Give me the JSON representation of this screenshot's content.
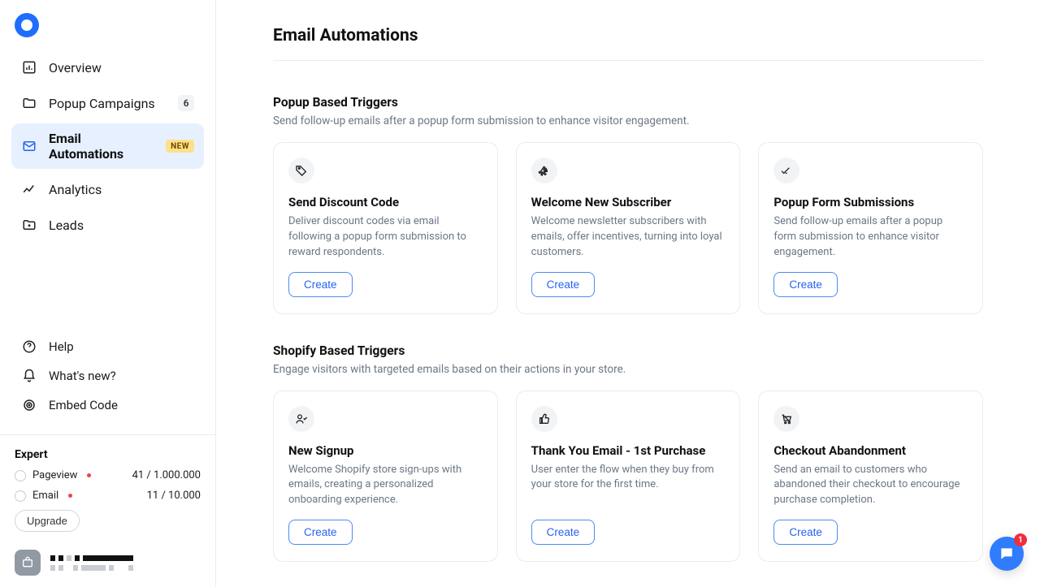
{
  "sidebar": {
    "nav": [
      {
        "label": "Overview"
      },
      {
        "label": "Popup Campaigns",
        "count": "6"
      },
      {
        "label": "Email Automations",
        "badge": "NEW"
      },
      {
        "label": "Analytics"
      },
      {
        "label": "Leads"
      }
    ],
    "secondary": [
      {
        "label": "Help"
      },
      {
        "label": "What's new?"
      },
      {
        "label": "Embed Code"
      }
    ],
    "plan": {
      "title": "Expert",
      "rows": [
        {
          "label": "Pageview",
          "value": "41 / 1.000.000"
        },
        {
          "label": "Email",
          "value": "11 / 10.000"
        }
      ],
      "upgrade": "Upgrade"
    }
  },
  "page": {
    "title": "Email Automations",
    "sections": [
      {
        "title": "Popup Based Triggers",
        "desc": "Send follow-up emails after a popup form submission to enhance visitor engagement.",
        "cards": [
          {
            "title": "Send Discount Code",
            "desc": "Deliver discount codes via email following a popup form submission to reward respondents.",
            "cta": "Create"
          },
          {
            "title": "Welcome New Subscriber",
            "desc": "Welcome newsletter subscribers with emails, offer incentives, turning into loyal customers.",
            "cta": "Create"
          },
          {
            "title": "Popup Form Submissions",
            "desc": "Send follow-up emails after a popup form submission to enhance visitor engagement.",
            "cta": "Create"
          }
        ]
      },
      {
        "title": "Shopify Based Triggers",
        "desc": "Engage visitors with targeted emails based on their actions in your store.",
        "cards": [
          {
            "title": "New Signup",
            "desc": "Welcome Shopify store sign-ups with emails, creating a personalized onboarding experience.",
            "cta": "Create"
          },
          {
            "title": "Thank You Email - 1st Purchase",
            "desc": "User enter the flow when they buy from your store for the first time.",
            "cta": "Create"
          },
          {
            "title": "Checkout Abandonment",
            "desc": "Send an email to customers who abandoned their checkout to encourage purchase completion.",
            "cta": "Create"
          }
        ]
      }
    ]
  },
  "chat": {
    "badge": "1"
  }
}
